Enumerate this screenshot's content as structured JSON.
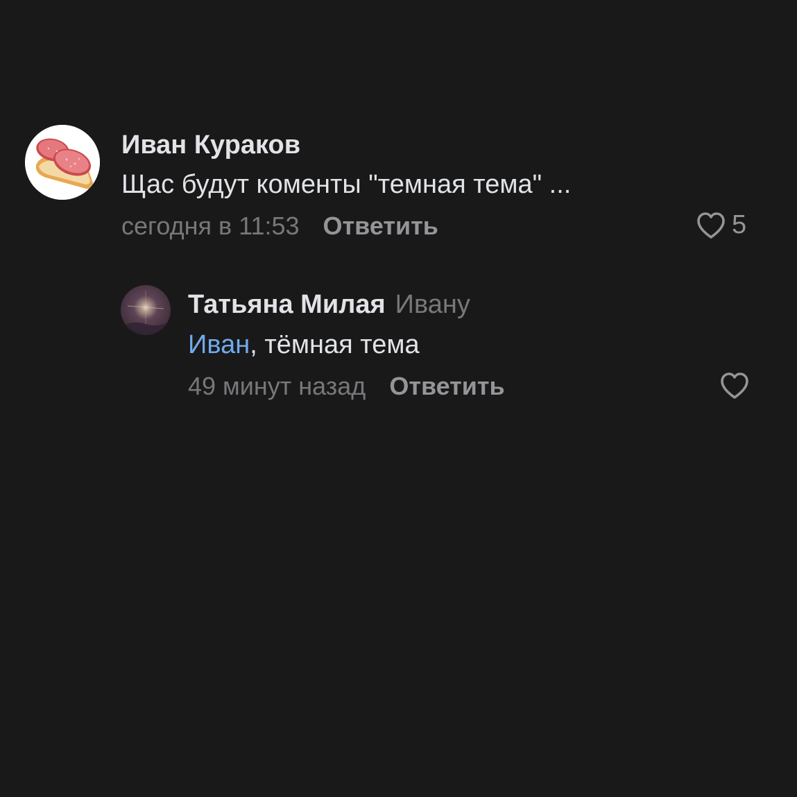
{
  "comments": [
    {
      "author": "Иван Кураков",
      "text": "Щас будут коменты \"темная тема\" ...",
      "time": "сегодня в 11:53",
      "reply_label": "Ответить",
      "likes": "5",
      "avatar_icon": "salami-sandwich-avatar"
    }
  ],
  "replies": [
    {
      "author": "Татьяна Милая",
      "reply_to": "Ивану",
      "mention": "Иван",
      "text_rest": ", тёмная тема",
      "time": "49 минут назад",
      "reply_label": "Ответить",
      "avatar_icon": "night-photo-avatar"
    }
  ],
  "colors": {
    "background": "#19191a",
    "primary_text": "#e1e3e6",
    "secondary_text": "#76787a",
    "action_text": "#939598",
    "mention": "#71aaeb"
  }
}
